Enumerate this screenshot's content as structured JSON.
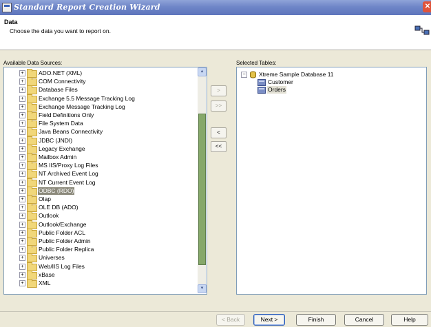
{
  "window": {
    "title": "Standard Report Creation Wizard"
  },
  "header": {
    "title": "Data",
    "subtitle": "Choose the data you want to report on."
  },
  "available": {
    "label": "Available Data Sources:",
    "items": [
      {
        "label": "ADO.NET (XML)",
        "selected": false
      },
      {
        "label": "COM Connectivity",
        "selected": false
      },
      {
        "label": "Database Files",
        "selected": false
      },
      {
        "label": "Exchange 5.5 Message Tracking Log",
        "selected": false
      },
      {
        "label": "Exchange Message Tracking Log",
        "selected": false
      },
      {
        "label": "Field Definitions Only",
        "selected": false
      },
      {
        "label": "File System Data",
        "selected": false
      },
      {
        "label": "Java Beans Connectivity",
        "selected": false
      },
      {
        "label": "JDBC (JNDI)",
        "selected": false
      },
      {
        "label": "Legacy Exchange",
        "selected": false
      },
      {
        "label": "Mailbox Admin",
        "selected": false
      },
      {
        "label": "MS IIS/Proxy Log Files",
        "selected": false
      },
      {
        "label": "NT Archived Event Log",
        "selected": false
      },
      {
        "label": "NT Current Event Log",
        "selected": false
      },
      {
        "label": "ODBC (RDO)",
        "selected": true
      },
      {
        "label": "Olap",
        "selected": false
      },
      {
        "label": "OLE DB (ADO)",
        "selected": false
      },
      {
        "label": "Outlook",
        "selected": false
      },
      {
        "label": "Outlook/Exchange",
        "selected": false
      },
      {
        "label": "Public Folder ACL",
        "selected": false
      },
      {
        "label": "Public Folder Admin",
        "selected": false
      },
      {
        "label": "Public Folder Replica",
        "selected": false
      },
      {
        "label": "Universes",
        "selected": false
      },
      {
        "label": "Web/IIS Log Files",
        "selected": false
      },
      {
        "label": "xBase",
        "selected": false
      },
      {
        "label": "XML",
        "selected": false
      }
    ]
  },
  "move_buttons": {
    "add": ">",
    "add_all": ">>",
    "remove": "<",
    "remove_all": "<<"
  },
  "selected": {
    "label": "Selected Tables:",
    "database": "Xtreme Sample Database 11",
    "tables": [
      "Customer",
      "Orders"
    ]
  },
  "footer": {
    "back": "< Back",
    "next": "Next >",
    "finish": "Finish",
    "cancel": "Cancel",
    "help": "Help"
  },
  "icons": {
    "expand": "plus-box-icon",
    "collapse": "minus-box-icon",
    "folder": "folder-icon",
    "database": "database-icon",
    "table": "table-icon",
    "close": "close-icon",
    "wizard": "wizard-icon"
  },
  "colors": {
    "title_bar": "#6F86C8",
    "selection": "#8C8A7C",
    "scroll_thumb": "#86A86A",
    "close": "#E0533A"
  }
}
